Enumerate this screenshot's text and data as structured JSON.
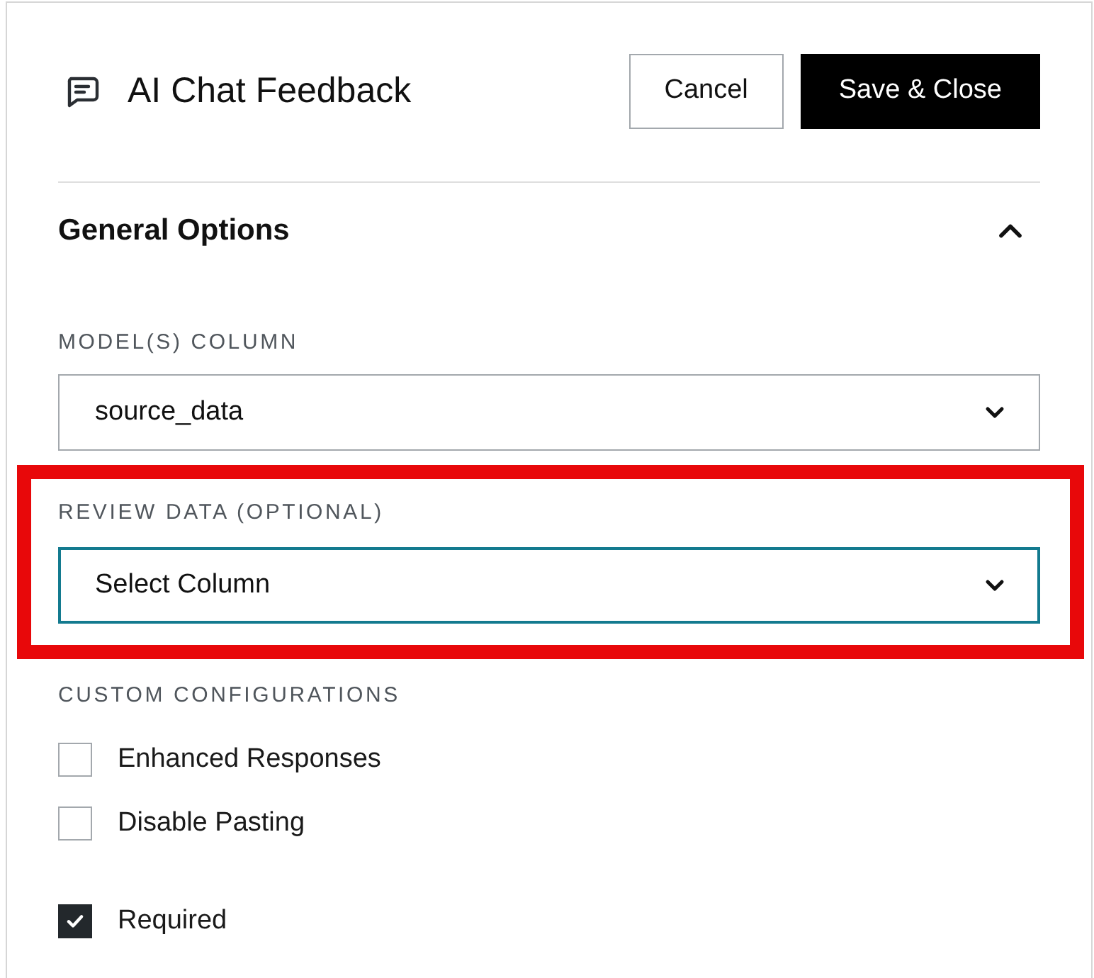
{
  "header": {
    "title": "AI Chat Feedback",
    "buttons": [
      {
        "label": "Cancel",
        "kind": "secondary"
      },
      {
        "label": "Save & Close",
        "kind": "primary"
      }
    ]
  },
  "section": {
    "title": "General Options",
    "expanded": true
  },
  "fields": [
    {
      "label": "MODEL(S) COLUMN",
      "value": "source_data",
      "focused": false,
      "highlighted": false
    },
    {
      "label": "REVIEW DATA (OPTIONAL)",
      "value": "Select Column",
      "focused": true,
      "highlighted": true
    }
  ],
  "custom_configurations": {
    "label": "CUSTOM CONFIGURATIONS",
    "options": [
      {
        "label": "Enhanced Responses",
        "checked": false
      },
      {
        "label": "Disable Pasting",
        "checked": false
      }
    ]
  },
  "required": {
    "label": "Required",
    "checked": true
  }
}
